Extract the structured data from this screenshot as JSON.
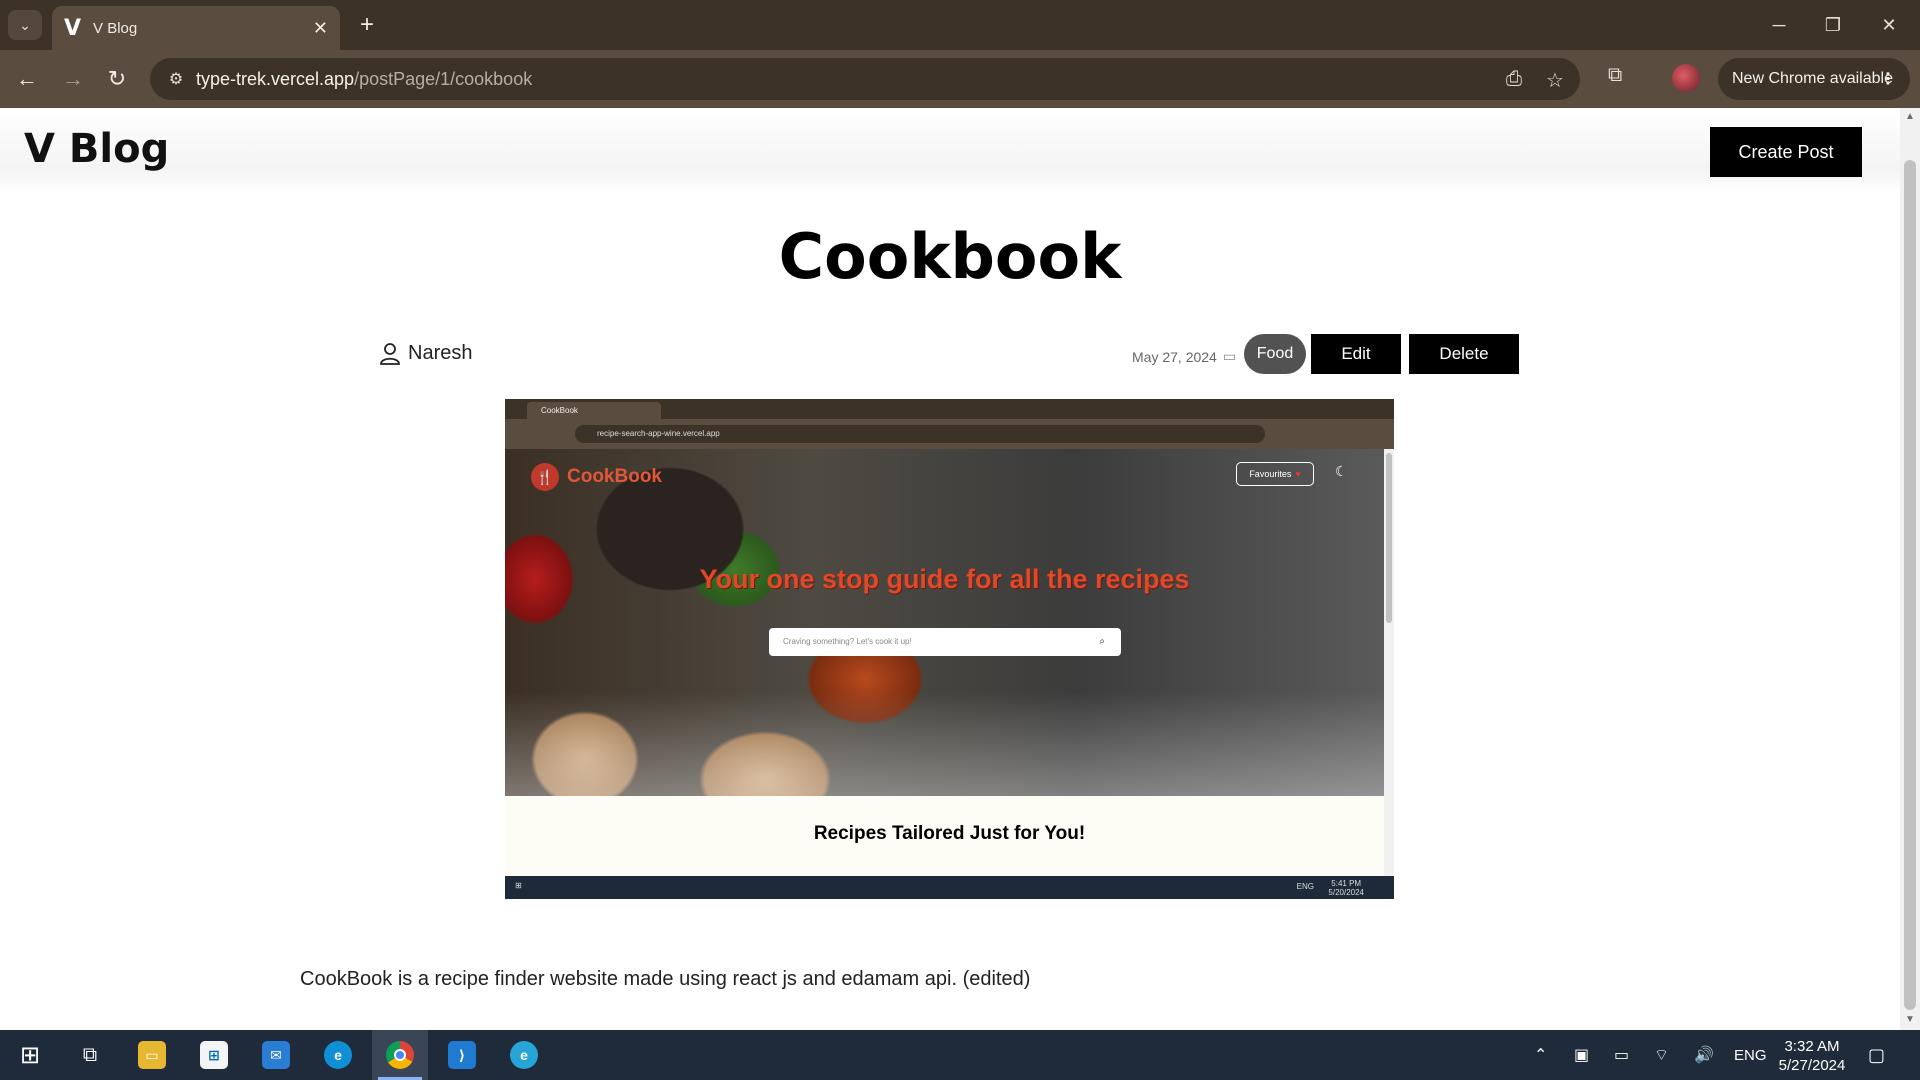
{
  "browser": {
    "tab_title": "V Blog",
    "tab_favicon": "V",
    "url_host": "type-trek.vercel.app",
    "url_path": "/postPage/1/cookbook",
    "update_label": "New Chrome available"
  },
  "site": {
    "logo_text": "V Blog",
    "create_label": "Create Post"
  },
  "post": {
    "title": "Cookbook",
    "author": "Naresh",
    "date": "May 27, 2024",
    "category": "Food",
    "edit_label": "Edit",
    "delete_label": "Delete",
    "body": "CookBook is a recipe finder website made using react js and edamam api. (edited)"
  },
  "embedded_screenshot": {
    "tab_title": "CookBook",
    "url": "recipe-search-app-wine.vercel.app",
    "brand": "CookBook",
    "favourites_label": "Favourites",
    "headline": "Your one stop guide for all the recipes",
    "search_placeholder": "Craving something? Let's cook it up!",
    "section_title": "Recipes Tailored Just for You!",
    "clock_time": "5:41 PM",
    "clock_date": "5/20/2024",
    "lang": "ENG"
  },
  "taskbar": {
    "lang": "ENG",
    "time": "3:32 AM",
    "date": "5/27/2024",
    "icons": [
      "windows-start-icon",
      "task-view-icon",
      "file-explorer-icon",
      "microsoft-store-icon",
      "mail-icon",
      "edge-icon",
      "chrome-icon",
      "vscode-icon",
      "edge-dev-icon"
    ]
  },
  "colors": {
    "chrome_frame": "#3c3228",
    "chrome_toolbar": "#5a4c3f",
    "accent_button": "#000000",
    "tag_bg": "#525252",
    "taskbar": "#1f2b3a"
  }
}
